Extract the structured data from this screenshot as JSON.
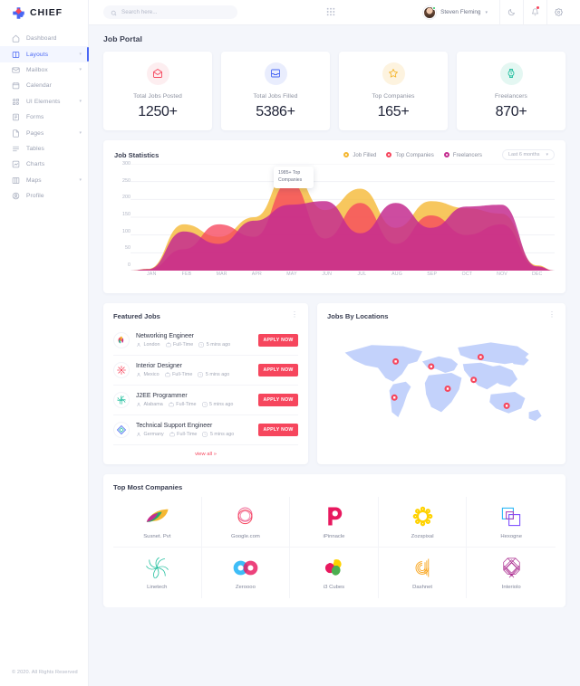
{
  "brand": {
    "name": "CHIEF",
    "logo_icon": "chief-cross-logo"
  },
  "sidebar": {
    "items": [
      {
        "label": "Dashboard",
        "icon": "home-icon",
        "active": false,
        "caret": false
      },
      {
        "label": "Layouts",
        "icon": "layout-icon",
        "active": true,
        "caret": true
      },
      {
        "label": "Mailbox",
        "icon": "mail-icon",
        "active": false,
        "caret": true
      },
      {
        "label": "Calendar",
        "icon": "calendar-icon",
        "active": false,
        "caret": false
      },
      {
        "label": "UI Elements",
        "icon": "grid-elements-icon",
        "active": false,
        "caret": true
      },
      {
        "label": "Forms",
        "icon": "form-icon",
        "active": false,
        "caret": false
      },
      {
        "label": "Pages",
        "icon": "pages-icon",
        "active": false,
        "caret": true
      },
      {
        "label": "Tables",
        "icon": "table-icon",
        "active": false,
        "caret": false
      },
      {
        "label": "Charts",
        "icon": "chart-icon",
        "active": false,
        "caret": false
      },
      {
        "label": "Maps",
        "icon": "map-icon",
        "active": false,
        "caret": true
      },
      {
        "label": "Profile",
        "icon": "profile-icon",
        "active": false,
        "caret": false
      }
    ],
    "copyright": "© 2020. All Rights Reserved"
  },
  "header": {
    "search_placeholder": "Search here...",
    "search_value": "",
    "search_icon": "search-icon",
    "apps_icon": "apps-grid-icon",
    "user_name": "Steven Fleming",
    "user_caret_icon": "chevron-down-icon",
    "status_online": true,
    "night_icon": "moon-icon",
    "bell_icon": "bell-icon",
    "bell_has_badge": true,
    "settings_icon": "gear-icon"
  },
  "page": {
    "title": "Job Portal"
  },
  "stats": [
    {
      "label": "Total Jobs Posted",
      "value": "1250+",
      "icon": "mail-open-icon",
      "color": "#f6465d",
      "bg": "#fdeef0"
    },
    {
      "label": "Total Jobs Filled",
      "value": "5386+",
      "icon": "inbox-icon",
      "color": "#4866f4",
      "bg": "#e9edfd"
    },
    {
      "label": "Top Companies",
      "value": "165+",
      "icon": "star-icon",
      "color": "#f5b731",
      "bg": "#fdf3df"
    },
    {
      "label": "Freelancers",
      "value": "870+",
      "icon": "watch-icon",
      "color": "#26c0a0",
      "bg": "#e4f7f2"
    }
  ],
  "chart_panel": {
    "title": "Job Statistics",
    "legend": [
      {
        "label": "Job Filled",
        "color": "#f5b731"
      },
      {
        "label": "Top Companies",
        "color": "#f6465d"
      },
      {
        "label": "Freelancers",
        "color": "#c42d8f"
      }
    ],
    "range_label": "Last 6 months",
    "range_caret_icon": "chevron-down-icon",
    "tooltip": {
      "line1": "1985+ Top",
      "line2": "Companies"
    }
  },
  "chart_data": {
    "type": "area",
    "title": "Job Statistics",
    "xlabel": "",
    "ylabel": "",
    "ylim": [
      0,
      300
    ],
    "yticks": [
      0,
      50,
      100,
      150,
      200,
      250,
      300
    ],
    "grid": true,
    "legend_position": "top-right",
    "categories": [
      "JAN",
      "FEB",
      "MAR",
      "APR",
      "MAY",
      "JUN",
      "JUL",
      "AUG",
      "SEP",
      "OCT",
      "NOV",
      "DEC"
    ],
    "series": [
      {
        "name": "Job Filled",
        "color": "#f5b731",
        "values": [
          5,
          130,
          95,
          150,
          285,
          170,
          230,
          120,
          195,
          175,
          160,
          15
        ]
      },
      {
        "name": "Top Companies",
        "color": "#f6465d",
        "values": [
          3,
          60,
          130,
          95,
          250,
          90,
          190,
          75,
          155,
          100,
          130,
          10
        ]
      },
      {
        "name": "Freelancers",
        "color": "#c42d8f",
        "values": [
          4,
          110,
          75,
          140,
          185,
          195,
          105,
          190,
          120,
          180,
          185,
          12
        ]
      }
    ],
    "annotations": [
      {
        "label": "1985+ Top Companies",
        "series": "Top Companies",
        "x": "MAY",
        "y": 250
      }
    ]
  },
  "featured_jobs": {
    "title": "Featured Jobs",
    "menu_icon": "more-vertical-icon",
    "location_icon": "user-location-icon",
    "type_icon": "briefcase-icon",
    "time_icon": "clock-icon",
    "view_all": "view all »",
    "items": [
      {
        "title": "Networking Engineer",
        "location": "London",
        "type": "Full-Time",
        "time": "5 mins ago",
        "button": "APPLY NOW",
        "logo": "leaf-burst-logo"
      },
      {
        "title": "Interior Designer",
        "location": "Mexico",
        "type": "Full-Time",
        "time": "5 mins ago",
        "button": "APPLY NOW",
        "logo": "snowflake-logo"
      },
      {
        "title": "J2EE Programmer",
        "location": "Alabama",
        "type": "Full-Time",
        "time": "5 mins ago",
        "button": "APPLY NOW",
        "logo": "spiral-logo"
      },
      {
        "title": "Technical Support Engineer",
        "location": "Germany",
        "type": "Full-Time",
        "time": "5 mins ago",
        "button": "APPLY NOW",
        "logo": "diamond-logo"
      }
    ]
  },
  "locations_panel": {
    "title": "Jobs By Locations",
    "menu_icon": "more-vertical-icon",
    "marker_icon": "map-pin-icon",
    "map_fill": "#c3d2fb",
    "marker_color": "#f6465d",
    "markers": [
      {
        "x": 108,
        "y": 52
      },
      {
        "x": 164,
        "y": 60
      },
      {
        "x": 242,
        "y": 45
      },
      {
        "x": 231,
        "y": 81
      },
      {
        "x": 190,
        "y": 95
      },
      {
        "x": 283,
        "y": 122
      },
      {
        "x": 106,
        "y": 109
      }
    ]
  },
  "companies": {
    "title": "Top Most Companies",
    "items": [
      {
        "name": "Susnet. Pvt",
        "logo": "leaf-swoosh-logo"
      },
      {
        "name": "Google.com",
        "logo": "circles-logo"
      },
      {
        "name": "iPinnacle",
        "logo": "p-letter-logo"
      },
      {
        "name": "Zozspixal",
        "logo": "sun-burst-logo"
      },
      {
        "name": "Hexogne",
        "logo": "squares-logo"
      },
      {
        "name": "Linetech",
        "logo": "swirl-lines-logo"
      },
      {
        "name": "Zeroooo",
        "logo": "infinity-logo"
      },
      {
        "name": "i3 Cubes",
        "logo": "petals-logo"
      },
      {
        "name": "Dashnet",
        "logo": "d-letter-logo"
      },
      {
        "name": "Interiolo",
        "logo": "octagon-logo"
      }
    ]
  }
}
